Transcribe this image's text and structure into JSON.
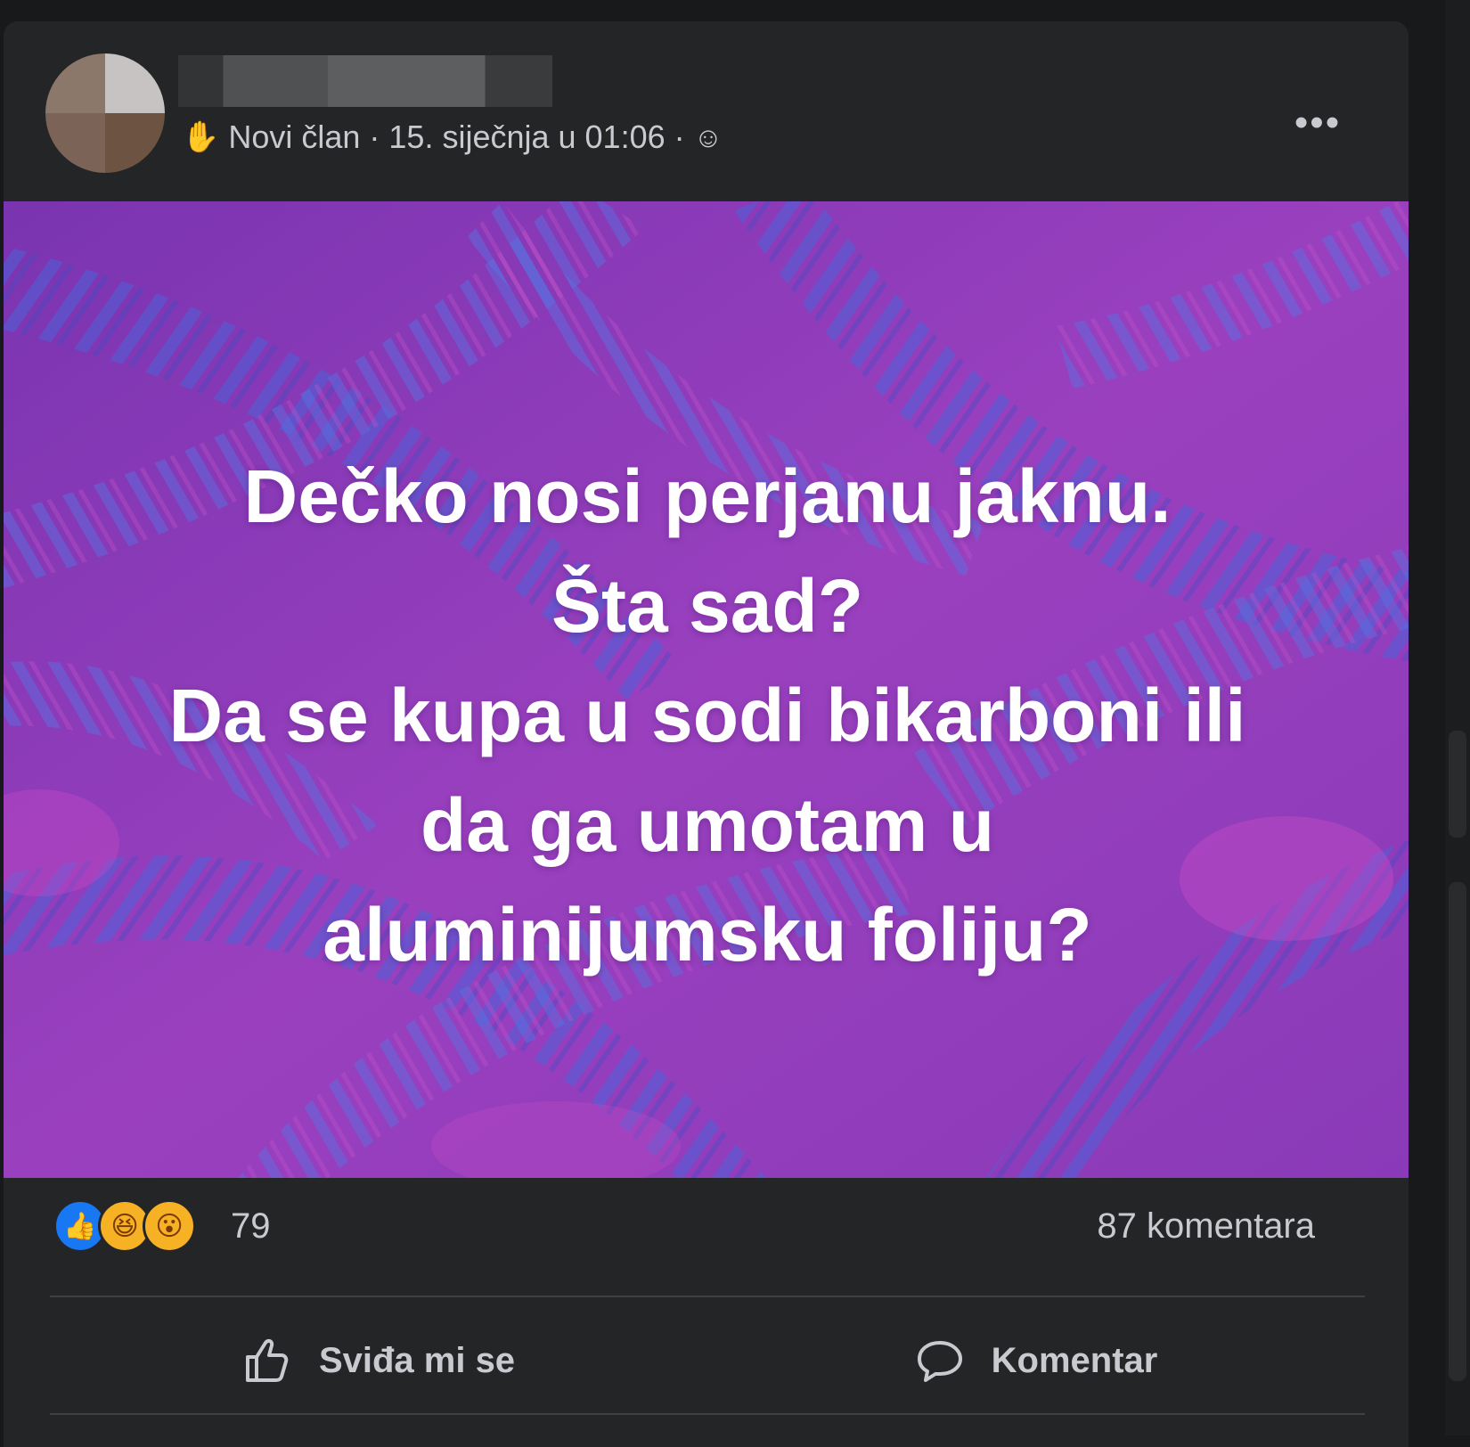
{
  "post": {
    "author_status": "Novi član",
    "separator_1": "·",
    "date": "15. siječnja u 01:06",
    "separator_2": "·",
    "privacy_icon": "group-members-icon",
    "more_label": "•••"
  },
  "media": {
    "lines": [
      "Dečko nosi perjanu jaknu.",
      "Šta sad?",
      "Da se kupa u sodi bikarboni ili",
      "da ga umotam u",
      "aluminijumsku foliju?"
    ]
  },
  "stats": {
    "reactions": [
      "like-reaction-icon",
      "haha-reaction-icon",
      "wow-reaction-icon"
    ],
    "reaction_count": "79",
    "comment_count": "87 komentara"
  },
  "actions": {
    "like_label": "Sviđa mi se",
    "comment_label": "Komentar"
  },
  "colors": {
    "card_bg": "#242526",
    "page_bg": "#18191a",
    "text_secondary": "#c8cacf",
    "background_purple": "#8d3ab5",
    "leaf_blue": "#4a5fd6",
    "like_blue": "#1877f2",
    "emoji_yellow": "#f7b125"
  }
}
